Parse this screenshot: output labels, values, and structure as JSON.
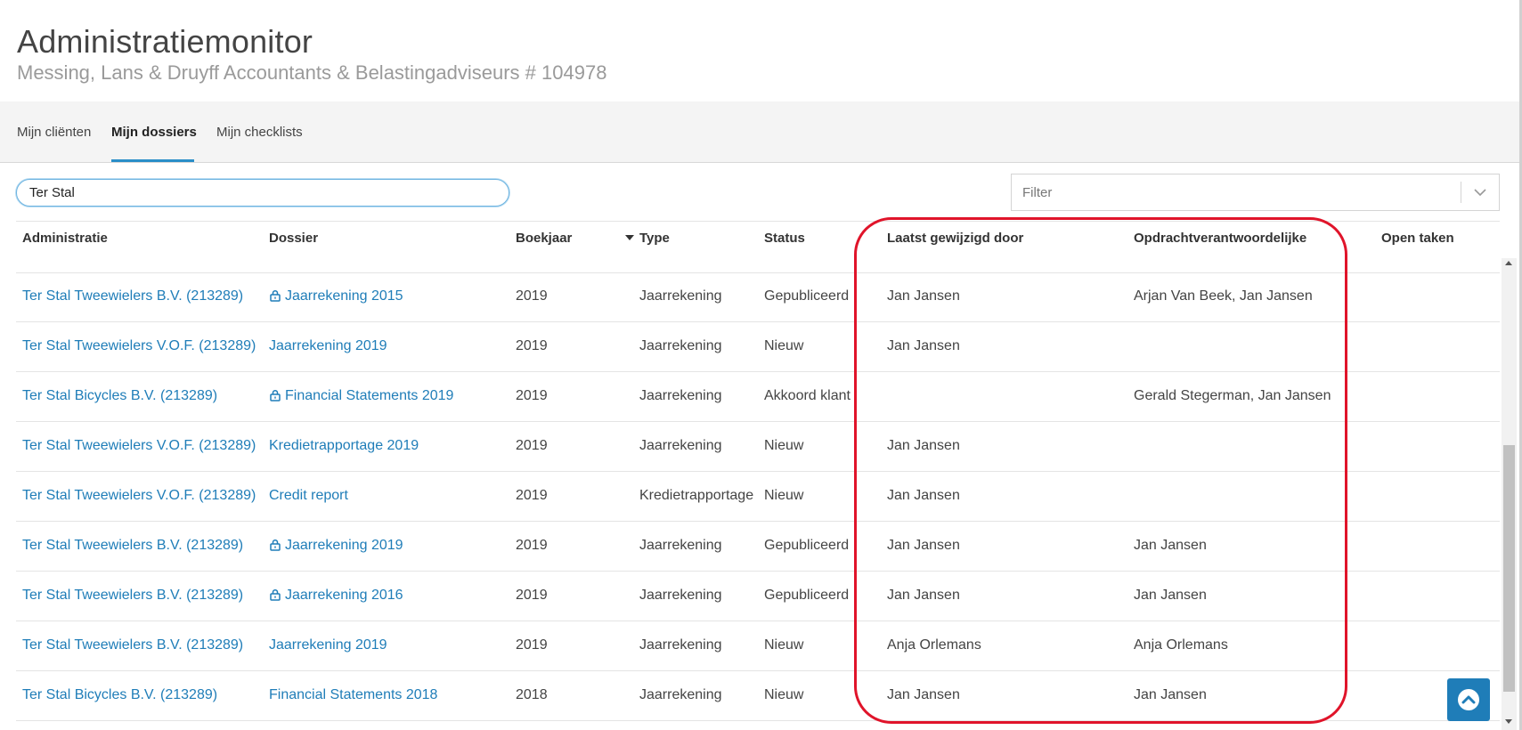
{
  "header": {
    "title": "Administratiemonitor",
    "subtitle": "Messing, Lans & Druyff Accountants & Belastingadviseurs # 104978"
  },
  "tabs": [
    {
      "label": "Mijn cliënten",
      "active": false
    },
    {
      "label": "Mijn dossiers",
      "active": true
    },
    {
      "label": "Mijn checklists",
      "active": false
    }
  ],
  "search": {
    "value": "Ter Stal"
  },
  "filter": {
    "placeholder": "Filter"
  },
  "table": {
    "columns": {
      "administratie": "Administratie",
      "dossier": "Dossier",
      "boekjaar": "Boekjaar",
      "type": "Type",
      "status": "Status",
      "laatst": "Laatst gewijzigd door",
      "opdracht": "Opdrachtverantwoordelijke",
      "open": "Open taken"
    },
    "sorted_column": "type",
    "rows": [
      {
        "administratie": "Ter Stal Tweewielers B.V. (213289)",
        "dossier": "Jaarrekening 2015",
        "locked": true,
        "boekjaar": "2019",
        "type": "Jaarrekening",
        "status": "Gepubliceerd",
        "laatst": "Jan Jansen",
        "opdracht": "Arjan Van Beek, Jan Jansen",
        "open": ""
      },
      {
        "administratie": "Ter Stal Tweewielers V.O.F. (213289)",
        "dossier": "Jaarrekening 2019",
        "locked": false,
        "boekjaar": "2019",
        "type": "Jaarrekening",
        "status": "Nieuw",
        "laatst": "Jan Jansen",
        "opdracht": "",
        "open": ""
      },
      {
        "administratie": "Ter Stal Bicycles B.V. (213289)",
        "dossier": "Financial Statements 2019",
        "locked": true,
        "boekjaar": "2019",
        "type": "Jaarrekening",
        "status": "Akkoord klant",
        "laatst": "",
        "opdracht": "Gerald Stegerman, Jan Jansen",
        "open": ""
      },
      {
        "administratie": "Ter Stal Tweewielers V.O.F. (213289)",
        "dossier": "Kredietrapportage 2019",
        "locked": false,
        "boekjaar": "2019",
        "type": "Jaarrekening",
        "status": "Nieuw",
        "laatst": "Jan Jansen",
        "opdracht": "",
        "open": ""
      },
      {
        "administratie": "Ter Stal Tweewielers V.O.F. (213289)",
        "dossier": "Credit report",
        "locked": false,
        "boekjaar": "2019",
        "type": "Kredietrapportage",
        "status": "Nieuw",
        "laatst": "Jan Jansen",
        "opdracht": "",
        "open": ""
      },
      {
        "administratie": "Ter Stal Tweewielers B.V. (213289)",
        "dossier": "Jaarrekening 2019",
        "locked": true,
        "boekjaar": "2019",
        "type": "Jaarrekening",
        "status": "Gepubliceerd",
        "laatst": "Jan Jansen",
        "opdracht": "Jan Jansen",
        "open": ""
      },
      {
        "administratie": "Ter Stal Tweewielers B.V. (213289)",
        "dossier": "Jaarrekening 2016",
        "locked": true,
        "boekjaar": "2019",
        "type": "Jaarrekening",
        "status": "Gepubliceerd",
        "laatst": "Jan Jansen",
        "opdracht": "Jan Jansen",
        "open": ""
      },
      {
        "administratie": "Ter Stal Tweewielers B.V. (213289)",
        "dossier": "Jaarrekening 2019",
        "locked": false,
        "boekjaar": "2019",
        "type": "Jaarrekening",
        "status": "Nieuw",
        "laatst": "Anja Orlemans",
        "opdracht": "Anja Orlemans",
        "open": ""
      },
      {
        "administratie": "Ter Stal Bicycles B.V. (213289)",
        "dossier": "Financial Statements 2018",
        "locked": false,
        "boekjaar": "2018",
        "type": "Jaarrekening",
        "status": "Nieuw",
        "laatst": "Jan Jansen",
        "opdracht": "Jan Jansen",
        "open": ""
      }
    ]
  },
  "colors": {
    "link": "#1f7db8",
    "accent": "#2a8ec8",
    "highlight": "#e0142a"
  },
  "icons": [
    "lock-icon",
    "chevron-down-icon",
    "chevron-up-icon",
    "sort-desc-icon"
  ]
}
